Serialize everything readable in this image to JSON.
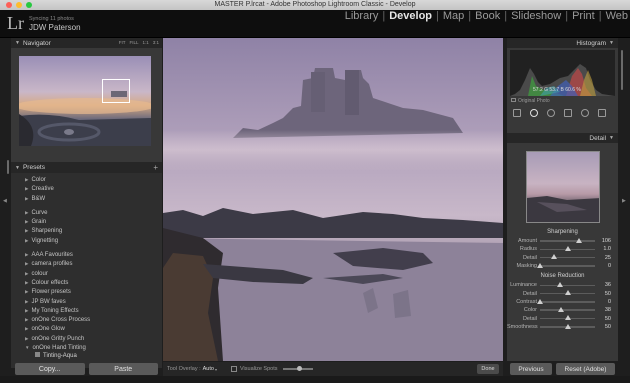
{
  "window": {
    "title": "MASTER P.lrcat - Adobe Photoshop Lightroom Classic - Develop",
    "traffic_colors": [
      "#fd5f57",
      "#febc2e",
      "#28c840"
    ]
  },
  "identity": {
    "logo": "Lr",
    "status": "Syncing 11 photos",
    "name": "JDW Paterson"
  },
  "modules": [
    "Library",
    "Develop",
    "Map",
    "Book",
    "Slideshow",
    "Print",
    "Web"
  ],
  "active_module": "Develop",
  "navigator": {
    "title": "Navigator",
    "options": [
      "FIT",
      "FILL",
      "1:1",
      "3:1"
    ]
  },
  "presets": {
    "title": "Presets",
    "add_symbol": "+",
    "items": [
      "Color",
      "Creative",
      "B&W",
      "",
      "Curve",
      "Grain",
      "Sharpening",
      "Vignetting",
      "",
      "AAA Favourites",
      "camera profiles",
      "colour",
      "Colour effects",
      "Flower presets",
      "JP BW faves",
      "My Toning Effects",
      "onOne Cross Process",
      "onOne Glow",
      "onOne Gritty Punch",
      "onOne Hand Tinting"
    ],
    "sub_item": "Tinting-Aqua"
  },
  "left_buttons": {
    "copy": "Copy...",
    "paste": "Paste"
  },
  "toolbar": {
    "tool_overlay_label": "Tool Overlay :",
    "tool_overlay_value": "Auto",
    "visualize_spots": "Visualize Spots",
    "done": "Done"
  },
  "histogram": {
    "title": "Histogram",
    "values": "57.2  G  53.7  B  60.6 %",
    "original_photo": "Original Photo"
  },
  "detail": {
    "title": "Detail",
    "sharpening_title": "Sharpening",
    "sharpening": [
      {
        "label": "Amount",
        "value": "106",
        "pos": 0.71
      },
      {
        "label": "Radius",
        "value": "1.0",
        "pos": 0.5
      },
      {
        "label": "Detail",
        "value": "25",
        "pos": 0.25
      },
      {
        "label": "Masking",
        "value": "0",
        "pos": 0.0
      }
    ],
    "noise_title": "Noise Reduction",
    "noise": [
      {
        "label": "Luminance",
        "value": "36",
        "pos": 0.36
      },
      {
        "label": "Detail",
        "value": "50",
        "pos": 0.5
      },
      {
        "label": "Contrast",
        "value": "0",
        "pos": 0.0
      },
      {
        "label": "Color",
        "value": "38",
        "pos": 0.38
      },
      {
        "label": "Detail",
        "value": "50",
        "pos": 0.5
      },
      {
        "label": "Smoothness",
        "value": "50",
        "pos": 0.5
      }
    ]
  },
  "right_buttons": {
    "previous": "Previous",
    "reset": "Reset (Adobe)"
  }
}
